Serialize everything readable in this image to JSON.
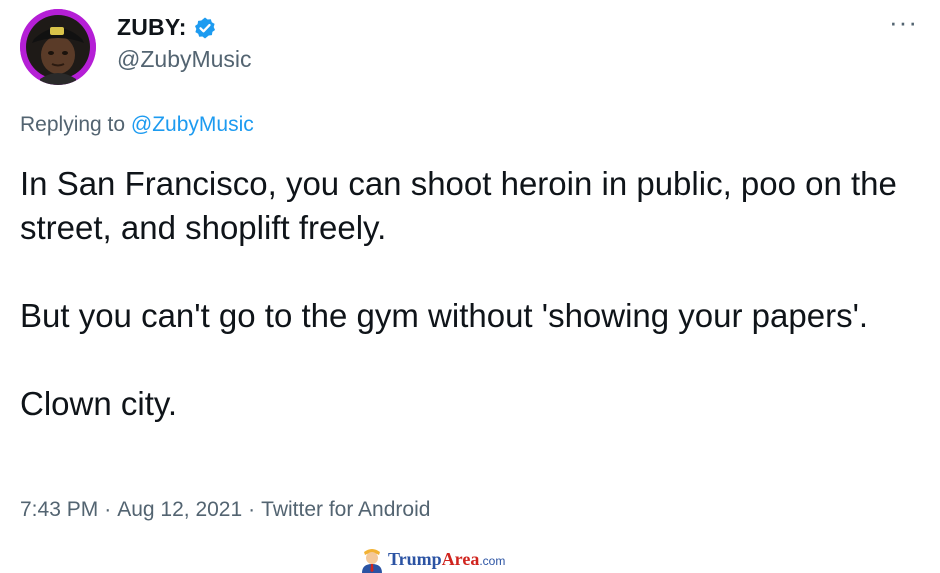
{
  "author": {
    "display_name": "ZUBY:",
    "handle": "@ZubyMusic",
    "avatar_icon": "user-avatar",
    "verified_icon": "verified-badge-icon",
    "verified_color": "#1d9bf0"
  },
  "menu": {
    "more_icon": "more-options-icon",
    "more_label": "···"
  },
  "reply": {
    "prefix": "Replying to",
    "mention": "@ZubyMusic"
  },
  "body": {
    "paragraphs": [
      "In San Francisco, you can shoot heroin in public, poo on the street, and shoplift freely.",
      "But you can't go to the gym without 'showing your papers'.",
      "Clown city."
    ]
  },
  "meta": {
    "time": "7:43 PM",
    "separator": "·",
    "date": "Aug 12, 2021",
    "source": "Twitter for Android"
  },
  "watermark": {
    "brand_main": "Trump",
    "brand_accent": "Area",
    "brand_suffix": ".com"
  },
  "colors": {
    "text": "#0f1419",
    "secondary": "#536471",
    "link": "#1d9bf0",
    "avatar_bg": "#b51fd6"
  }
}
